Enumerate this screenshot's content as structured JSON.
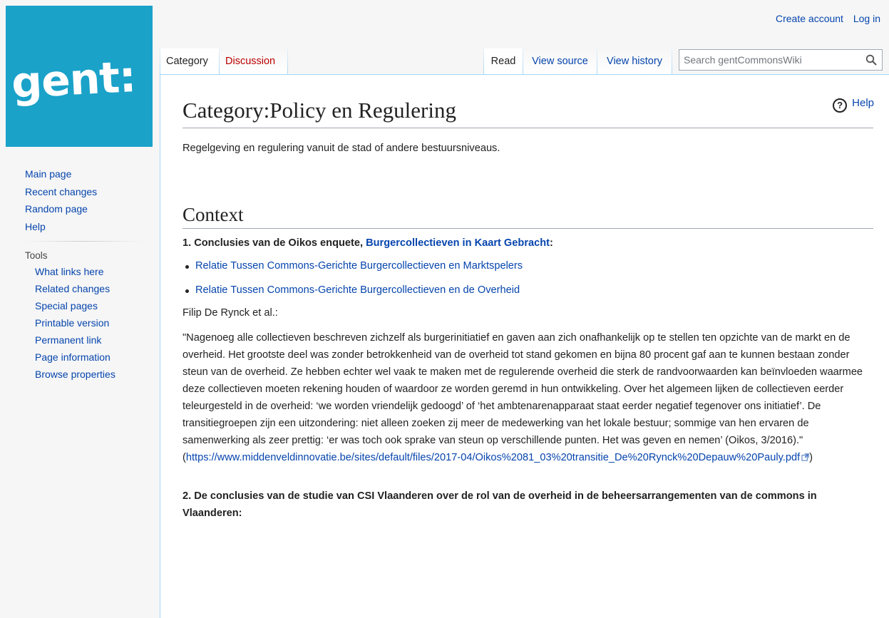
{
  "logo": {
    "text": "gent:",
    "color": "#1aa2c9"
  },
  "personal": {
    "create_account": "Create account",
    "log_in": "Log in"
  },
  "tabs": {
    "category": "Category",
    "discussion": "Discussion",
    "read": "Read",
    "view_source": "View source",
    "view_history": "View history"
  },
  "search": {
    "placeholder": "Search gentCommonsWiki",
    "icon": "magnifier-icon"
  },
  "sidebar": {
    "nav": [
      "Main page",
      "Recent changes",
      "Random page",
      "Help"
    ],
    "tools_heading": "Tools",
    "tools": [
      "What links here",
      "Related changes",
      "Special pages",
      "Printable version",
      "Permanent link",
      "Page information",
      "Browse properties"
    ]
  },
  "content": {
    "help_icon": "?",
    "help_label": "Help",
    "title": "Category:Policy en Regulering",
    "intro": "Regelgeving en regulering vanuit de stad of andere bestuursniveaus.",
    "context_heading": "Context",
    "c1_prefix": "1. Conclusies van de Oikos enquete, ",
    "c1_link": "Burgercollectieven in Kaart Gebracht",
    "c1_suffix": ":",
    "list": [
      "Relatie Tussen Commons-Gerichte Burgercollectieven en Marktspelers",
      "Relatie Tussen Commons-Gerichte Burgercollectieven en de Overheid"
    ],
    "author": "Filip De Rynck et al.:",
    "quote": "\"Nagenoeg alle collectieven beschreven zichzelf als burgerinitiatief en gaven aan zich onafhankelijk op te stellen ten opzichte van de markt en de overheid. Het grootste deel was zonder betrokkenheid van de overheid tot stand gekomen en bijna 80 procent gaf aan te kunnen bestaan zonder steun van de overheid. Ze hebben echter wel vaak te maken met de regulerende overheid die sterk de randvoorwaarden kan beïnvloeden waarmee deze collectieven moeten rekening houden of waardoor ze worden geremd in hun ontwikkeling. Over het algemeen lijken de collectieven eerder teleurgesteld in de overheid: ‘we worden vriendelijk gedoogd’ of ‘het ambtenarenapparaat staat eerder negatief tegenover ons initiatief’. De transitiegroepen zijn een uitzondering: niet alleen zoeken zij meer de medewerking van het lokale bestuur; sommige van hen ervaren de samenwerking als zeer prettig: ‘er was toch ook sprake van steun op verschillende punten. Het was geven en nemen’ (Oikos, 3/2016).\" (",
    "quote_link": "https://www.middenveldinnovatie.be/sites/default/files/2017-04/Oikos%2081_03%20transitie_De%20Rynck%20Depauw%20Pauly.pdf",
    "quote_end": ")",
    "c2_heading": "2. De conclusies van de studie van CSI Vlaanderen over de rol van de overheid in de beheersarrangementen van de commons in Vlaanderen:"
  }
}
